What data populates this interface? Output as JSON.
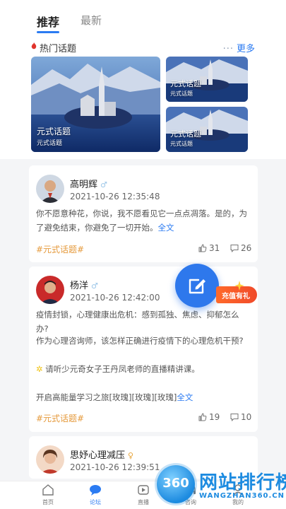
{
  "tabs": {
    "recommend": "推荐",
    "latest": "最新"
  },
  "hot_topics": {
    "title": "热门话题",
    "more_label": "更多",
    "more_dots": "···",
    "cards": [
      {
        "title": "元式话题",
        "subtitle": "元式话题"
      },
      {
        "title": "元式话题",
        "subtitle": "元式话题"
      },
      {
        "title": "元式话题",
        "subtitle": "元式话题"
      }
    ]
  },
  "posts": [
    {
      "username": "高明辉",
      "gender_symbol": "♂",
      "time": "2021-10-26 12:35:48",
      "content": "你不愿意种花，你说，我不愿看见它一点点凋落。是的，为了避免结束，你避免了一切开始。",
      "full_text_link": "全文",
      "tag": "#元式话题#",
      "likes": "31",
      "comments": "26"
    },
    {
      "username": "杨洋",
      "gender_symbol": "♂",
      "time": "2021-10-26 12:42:00",
      "paragraphs": [
        "疫情封锁，心理健康出危机：感到孤独、焦虑、抑郁怎么办?",
        "作为心理咨询师，该怎样正确进行疫情下的心理危机干预?",
        "请听少元奇女子王丹凤老师的直播精讲课。",
        "开启高能量学习之旅[玫瑰][玫瑰][玫瑰]"
      ],
      "full_text_link": "全文",
      "tag": "#元式话题#",
      "likes": "19",
      "comments": "10"
    },
    {
      "username": "思妤心理减压",
      "gender_symbol": "♀",
      "time": "2021-10-26 12:39:51"
    }
  ],
  "recharge_badge": "充值有礼",
  "bottom_nav": {
    "items": [
      {
        "label": "首页"
      },
      {
        "label": "论坛"
      },
      {
        "label": "直播"
      },
      {
        "label": "咨询"
      },
      {
        "label": "我的"
      }
    ]
  },
  "watermark": {
    "logo_text": "360",
    "title": "网站排行榜",
    "url": "WANGZHAN360.CN"
  },
  "colors": {
    "accent": "#2b7bf2",
    "tag": "#e59a3c",
    "fab": "#2e78ec",
    "badge": "#f04a2a"
  }
}
